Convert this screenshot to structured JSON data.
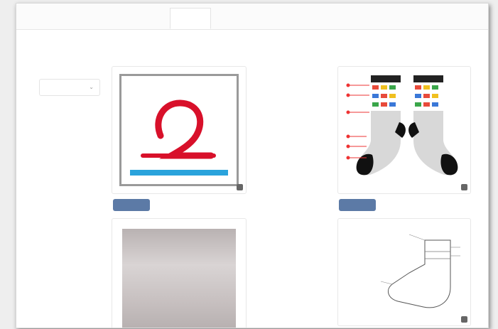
{
  "tabs": [
    {
      "label": ""
    },
    {
      "label": ""
    },
    {
      "label": ""
    },
    {
      "label": ""
    },
    {
      "label": ""
    }
  ],
  "left_section": {
    "title": "",
    "select_label": "",
    "select_value": "",
    "upload_button": "",
    "upload_hint": "",
    "bottom_label": ""
  },
  "right_section": {
    "title": "",
    "image_label": "",
    "upload_button": "",
    "upload_hint": "",
    "bottom_label": "",
    "diagram_title": "",
    "diagram_side_label": ""
  },
  "colors": {
    "tab_active_text": "#4a7fe0",
    "button": "#5c7aa6",
    "hint_text": "#e06666",
    "logo_red": "#d8102a",
    "logo_blue": "#2aa3dc"
  }
}
